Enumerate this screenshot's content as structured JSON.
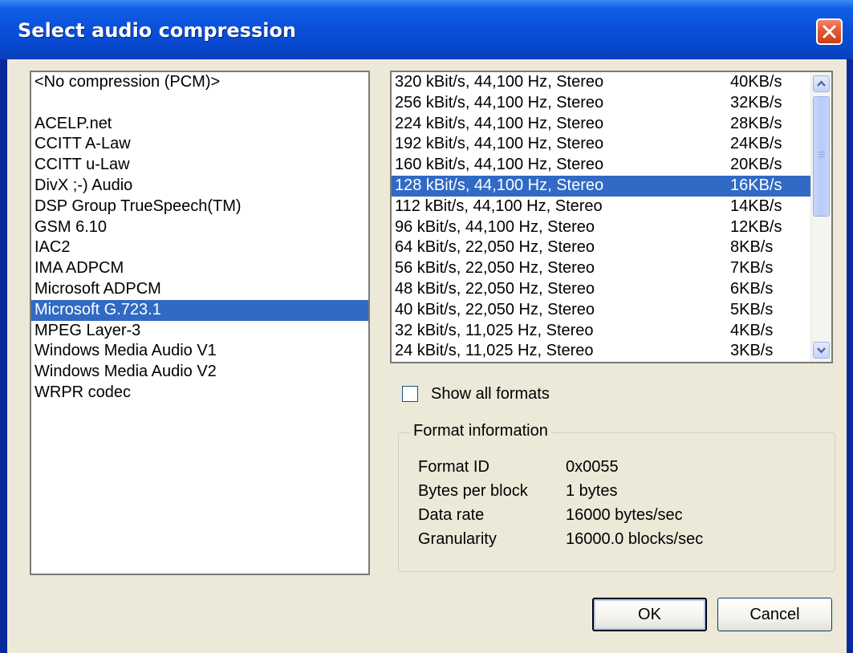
{
  "window": {
    "title": "Select audio compression",
    "close_icon": "close-icon"
  },
  "codecs": {
    "selected_index": 11,
    "items": [
      "<No compression (PCM)>",
      "",
      "ACELP.net",
      "CCITT A-Law",
      "CCITT u-Law",
      "DivX ;-) Audio",
      "DSP Group TrueSpeech(TM)",
      "GSM 6.10",
      "IAC2",
      "IMA ADPCM",
      "Microsoft ADPCM",
      "Microsoft G.723.1",
      "MPEG Layer-3",
      "Windows Media Audio V1",
      "Windows Media Audio V2",
      "WRPR codec"
    ]
  },
  "formats": {
    "selected_index": 5,
    "items": [
      {
        "format": "320 kBit/s, 44,100 Hz, Stereo",
        "rate": "40KB/s"
      },
      {
        "format": "256 kBit/s, 44,100 Hz, Stereo",
        "rate": "32KB/s"
      },
      {
        "format": "224 kBit/s, 44,100 Hz, Stereo",
        "rate": "28KB/s"
      },
      {
        "format": "192 kBit/s, 44,100 Hz, Stereo",
        "rate": "24KB/s"
      },
      {
        "format": "160 kBit/s, 44,100 Hz, Stereo",
        "rate": "20KB/s"
      },
      {
        "format": "128 kBit/s, 44,100 Hz, Stereo",
        "rate": "16KB/s"
      },
      {
        "format": "112 kBit/s, 44,100 Hz, Stereo",
        "rate": "14KB/s"
      },
      {
        "format": "96 kBit/s, 44,100 Hz, Stereo",
        "rate": "12KB/s"
      },
      {
        "format": "64 kBit/s, 22,050 Hz, Stereo",
        "rate": "8KB/s"
      },
      {
        "format": "56 kBit/s, 22,050 Hz, Stereo",
        "rate": "7KB/s"
      },
      {
        "format": "48 kBit/s, 22,050 Hz, Stereo",
        "rate": "6KB/s"
      },
      {
        "format": "40 kBit/s, 22,050 Hz, Stereo",
        "rate": "5KB/s"
      },
      {
        "format": "32 kBit/s, 11,025 Hz, Stereo",
        "rate": "4KB/s"
      },
      {
        "format": "24 kBit/s, 11,025 Hz, Stereo",
        "rate": "3KB/s"
      }
    ]
  },
  "show_all_formats": {
    "label": "Show all formats",
    "checked": false
  },
  "format_info": {
    "legend": "Format information",
    "rows": [
      {
        "key": "Format ID",
        "value": "0x0055"
      },
      {
        "key": "Bytes per block",
        "value": "1 bytes"
      },
      {
        "key": "Data rate",
        "value": "16000 bytes/sec"
      },
      {
        "key": "Granularity",
        "value": "16000.0 blocks/sec"
      }
    ]
  },
  "buttons": {
    "ok": "OK",
    "cancel": "Cancel"
  },
  "colors": {
    "titlebar": "#0a4fd8",
    "selection": "#316ac5",
    "dialog_face": "#ece9d8",
    "close_button": "#e05a35"
  }
}
